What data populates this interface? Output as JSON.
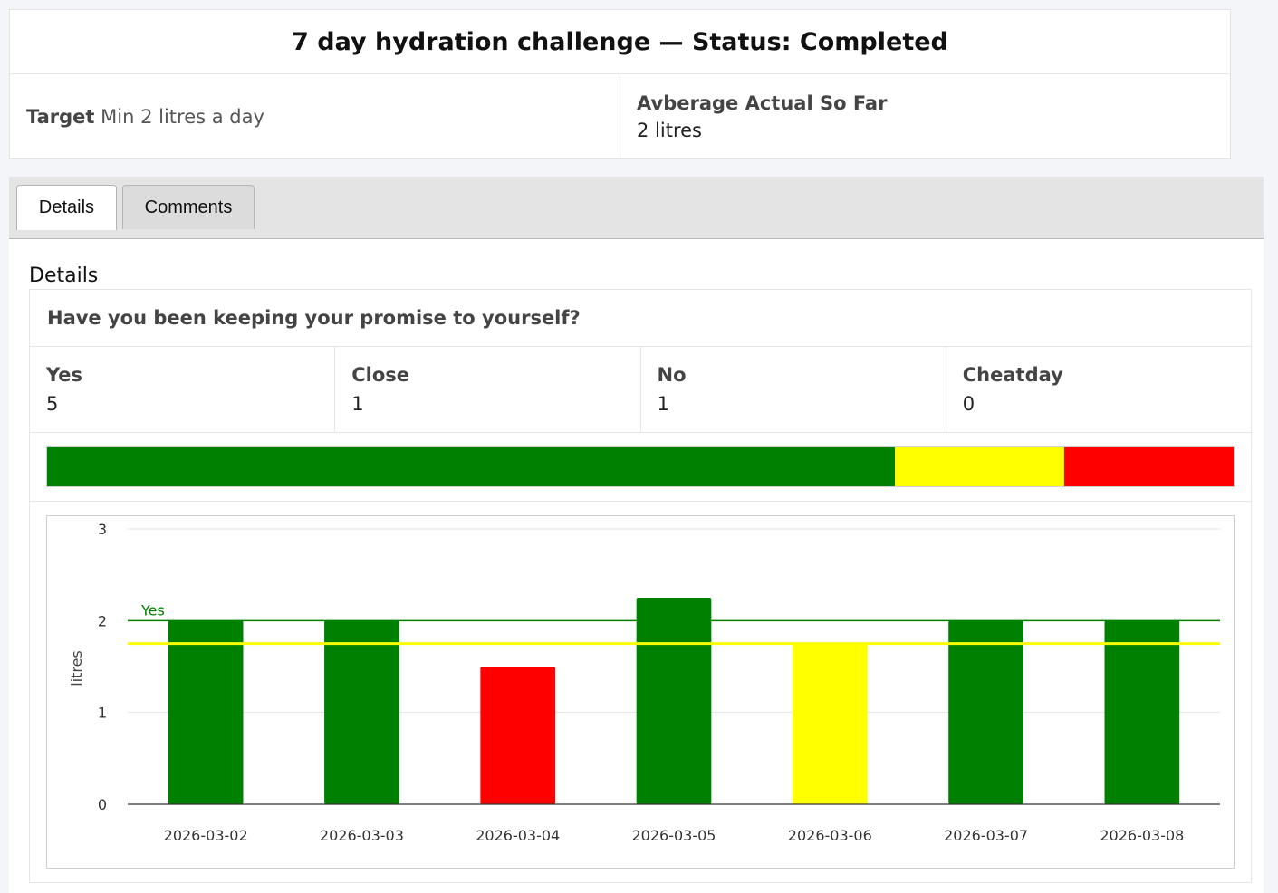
{
  "header": {
    "title": "7 day hydration challenge — Status: Completed",
    "target_label": "Target",
    "target_value": "Min 2 litres a day",
    "average_label": "Avberage Actual So Far",
    "average_value": "2 litres"
  },
  "tabs": [
    {
      "label": "Details",
      "active": true
    },
    {
      "label": "Comments",
      "active": false
    }
  ],
  "section_label": "Details",
  "panel": {
    "question": "Have you been keeping your promise to yourself?",
    "stats": [
      {
        "label": "Yes",
        "value": "5"
      },
      {
        "label": "Close",
        "value": "1"
      },
      {
        "label": "No",
        "value": "1"
      },
      {
        "label": "Cheatday",
        "value": "0"
      }
    ],
    "progress": [
      {
        "status": "Yes",
        "count": 5,
        "color": "#008000"
      },
      {
        "status": "Close",
        "count": 1,
        "color": "#ffff00"
      },
      {
        "status": "No",
        "count": 1,
        "color": "#ff0000"
      }
    ]
  },
  "chart_data": {
    "type": "bar",
    "categories": [
      "2026-03-02",
      "2026-03-03",
      "2026-03-04",
      "2026-03-05",
      "2026-03-06",
      "2026-03-07",
      "2026-03-08"
    ],
    "values": [
      2.0,
      2.0,
      1.5,
      2.25,
      1.75,
      2.0,
      2.0
    ],
    "bar_colors": [
      "#008000",
      "#008000",
      "#ff0000",
      "#008000",
      "#ffff00",
      "#008000",
      "#008000"
    ],
    "ylabel": "litres",
    "ylim": [
      0,
      3
    ],
    "yticks": [
      "0",
      "1",
      "2",
      "3"
    ],
    "reference_lines": [
      {
        "value": 2.0,
        "label": "Yes",
        "color": "#008000"
      },
      {
        "value": 1.75,
        "label": "",
        "color": "#ffff00"
      }
    ],
    "grid": true
  }
}
